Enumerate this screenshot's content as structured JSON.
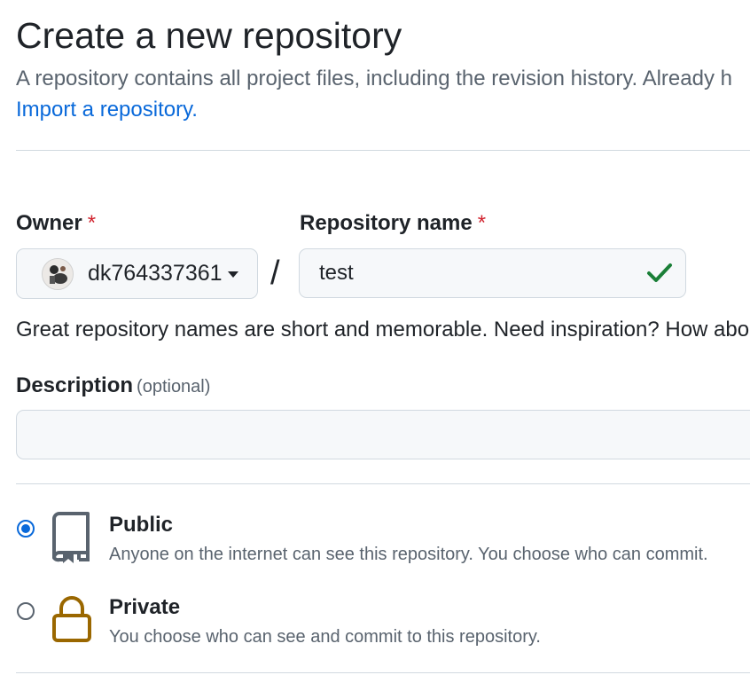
{
  "header": {
    "title": "Create a new repository",
    "subtitle": "A repository contains all project files, including the revision history. Already h",
    "import_link": "Import a repository."
  },
  "owner": {
    "label": "Owner",
    "required_mark": "*",
    "selected": "dk764337361"
  },
  "separator": "/",
  "repository": {
    "label": "Repository name",
    "required_mark": "*",
    "value": "test",
    "valid_icon": "check-icon",
    "hint": "Great repository names are short and memorable. Need inspiration? How abo"
  },
  "description": {
    "label": "Description",
    "optional_label": "(optional)",
    "value": ""
  },
  "visibility": {
    "options": [
      {
        "title": "Public",
        "description": "Anyone on the internet can see this repository. You choose who can commit.",
        "icon": "repo-book-icon",
        "checked": true
      },
      {
        "title": "Private",
        "description": "You choose who can see and commit to this repository.",
        "icon": "lock-icon",
        "checked": false
      }
    ]
  },
  "colors": {
    "link": "#0969da",
    "required": "#d1242f",
    "success": "#1a7f37",
    "lock": "#9a6700"
  }
}
